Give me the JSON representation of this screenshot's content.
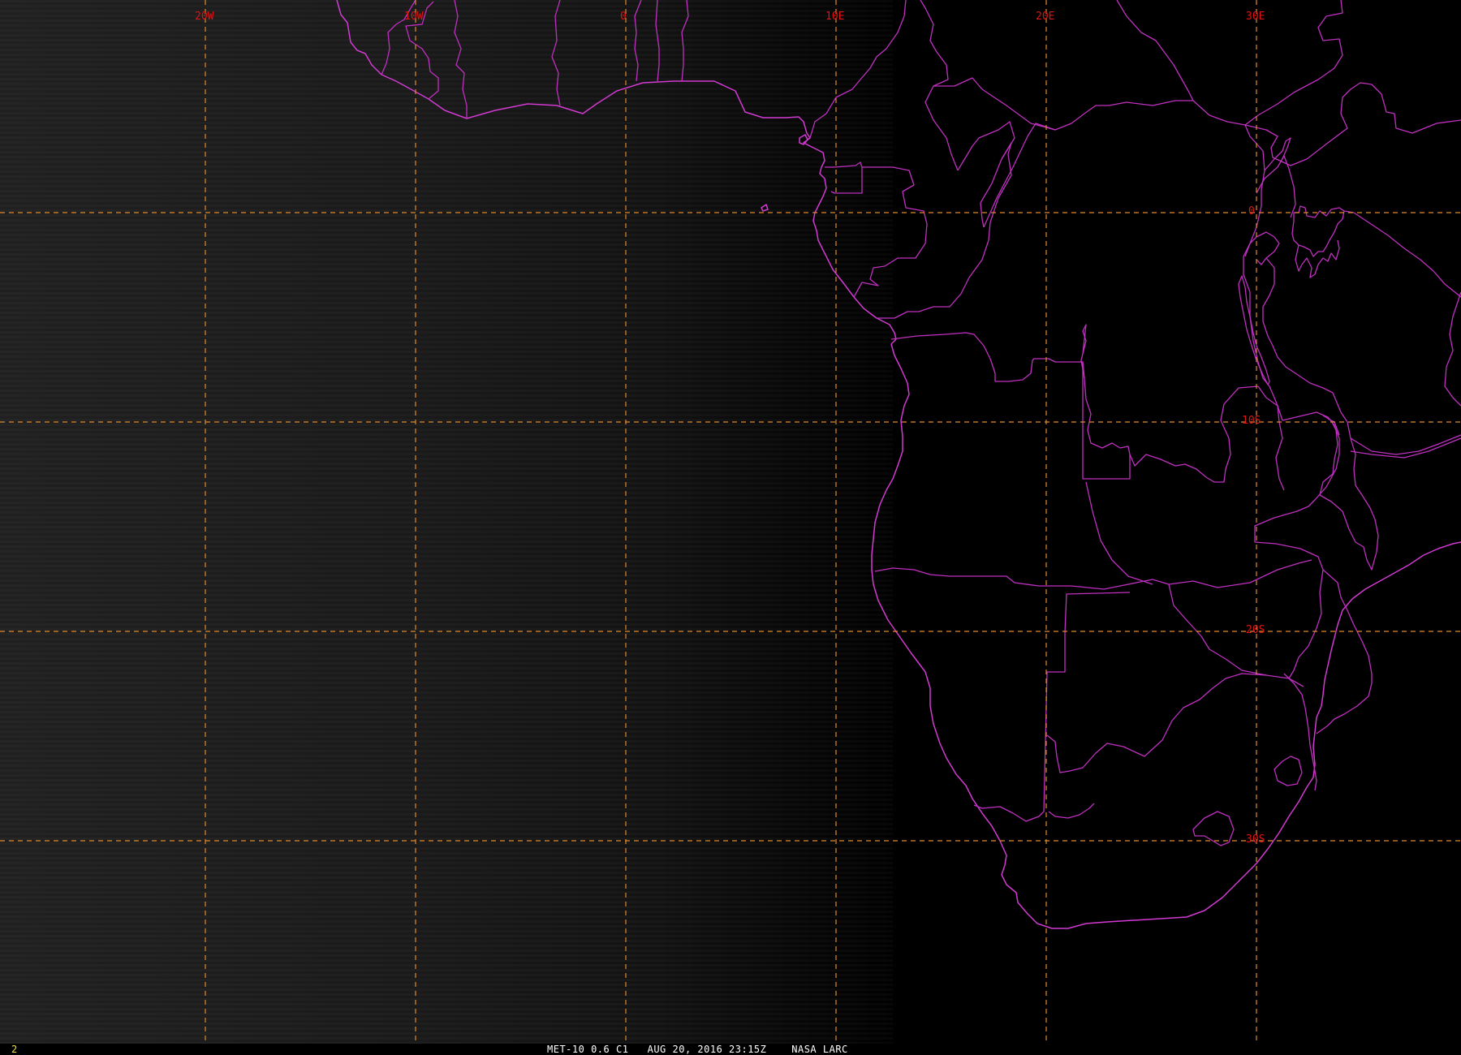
{
  "image": {
    "sensor_caption": "MET-10 0.6 C1   AUG 20, 2016 23:15Z    NASA LARC",
    "frame_number": "2"
  },
  "colors": {
    "background": "#000000",
    "gridline": "#e08a2c",
    "grid_label": "#e01414",
    "boundary": "#c030c0",
    "frame_number": "#f0e040",
    "caption": "#ffffff"
  },
  "grid": {
    "longitude_labels": [
      "20W",
      "10W",
      "0",
      "10E",
      "20E",
      "30E"
    ],
    "latitude_labels": [
      "0",
      "10S",
      "20S",
      "30S"
    ]
  },
  "layers": [
    "satellite-visible-channel",
    "country-boundaries",
    "coastlines",
    "lat-lon-grid"
  ]
}
